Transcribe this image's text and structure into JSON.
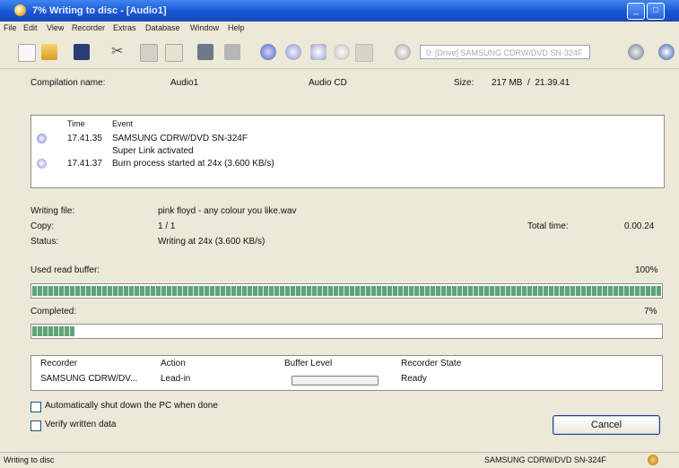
{
  "window": {
    "title": "7% Writing to disc - [Audio1]"
  },
  "menu": [
    "File",
    "Edit",
    "View",
    "Recorder",
    "Extras",
    "Database",
    "Window",
    "Help"
  ],
  "toolbar": {
    "icons": [
      "new-icon",
      "open-icon",
      "save-icon",
      "cut-icon",
      "copy-icon",
      "paste-icon",
      "edit-icon",
      "properties-icon",
      "burn-icon",
      "disc-copy-icon",
      "erase-icon",
      "search-icon",
      "info-icon"
    ],
    "drive_select_value": "0: [Drive] SAMSUNG CDRW/DVD SN-324F"
  },
  "compilation": {
    "name_label": "Compilation name:",
    "name_value": "Audio1",
    "type": "Audio CD",
    "size_label": "Size:",
    "size_value": "217 MB  /  21.39.41"
  },
  "events": {
    "col_time": "Time",
    "col_event": "Event",
    "rows": [
      {
        "time": "17.41.35",
        "text": "SAMSUNG CDRW/DVD SN-324F"
      },
      {
        "time": "",
        "text": "Super Link activated"
      },
      {
        "time": "17.41.37",
        "text": "Burn process started at 24x (3.600 KB/s)"
      }
    ]
  },
  "details": {
    "writing_file_label": "Writing file:",
    "writing_file_value": "pink floyd - any colour you like.wav",
    "copy_label": "Copy:",
    "copy_value": "1 / 1",
    "total_time_label": "Total time:",
    "total_time_value": "0.00.24",
    "status_label": "Status:",
    "status_value": "Writing at 24x (3.600 KB/s)"
  },
  "buffer": {
    "label": "Used read buffer:",
    "percent_text": "100%",
    "fraction": 1.0
  },
  "completed": {
    "label": "Completed:",
    "percent_text": "7%",
    "fraction": 0.07
  },
  "recorder_table": {
    "headers": [
      "Recorder",
      "Action",
      "Buffer Level",
      "Recorder State"
    ],
    "row": {
      "recorder": "SAMSUNG CDRW/DV...",
      "action": "Lead-in",
      "buffer_fraction": 0.0,
      "state": "Ready"
    }
  },
  "options": {
    "auto_shutdown": "Automatically shut down the PC when done",
    "verify": "Verify written data"
  },
  "buttons": {
    "cancel": "Cancel"
  },
  "statusbar": {
    "left": "Writing to disc",
    "right": "SAMSUNG CDRW/DVD SN-324F"
  },
  "colors": {
    "title_blue": "#1a56d6",
    "progress_green": "#5fa476",
    "background": "#ece9d8"
  }
}
